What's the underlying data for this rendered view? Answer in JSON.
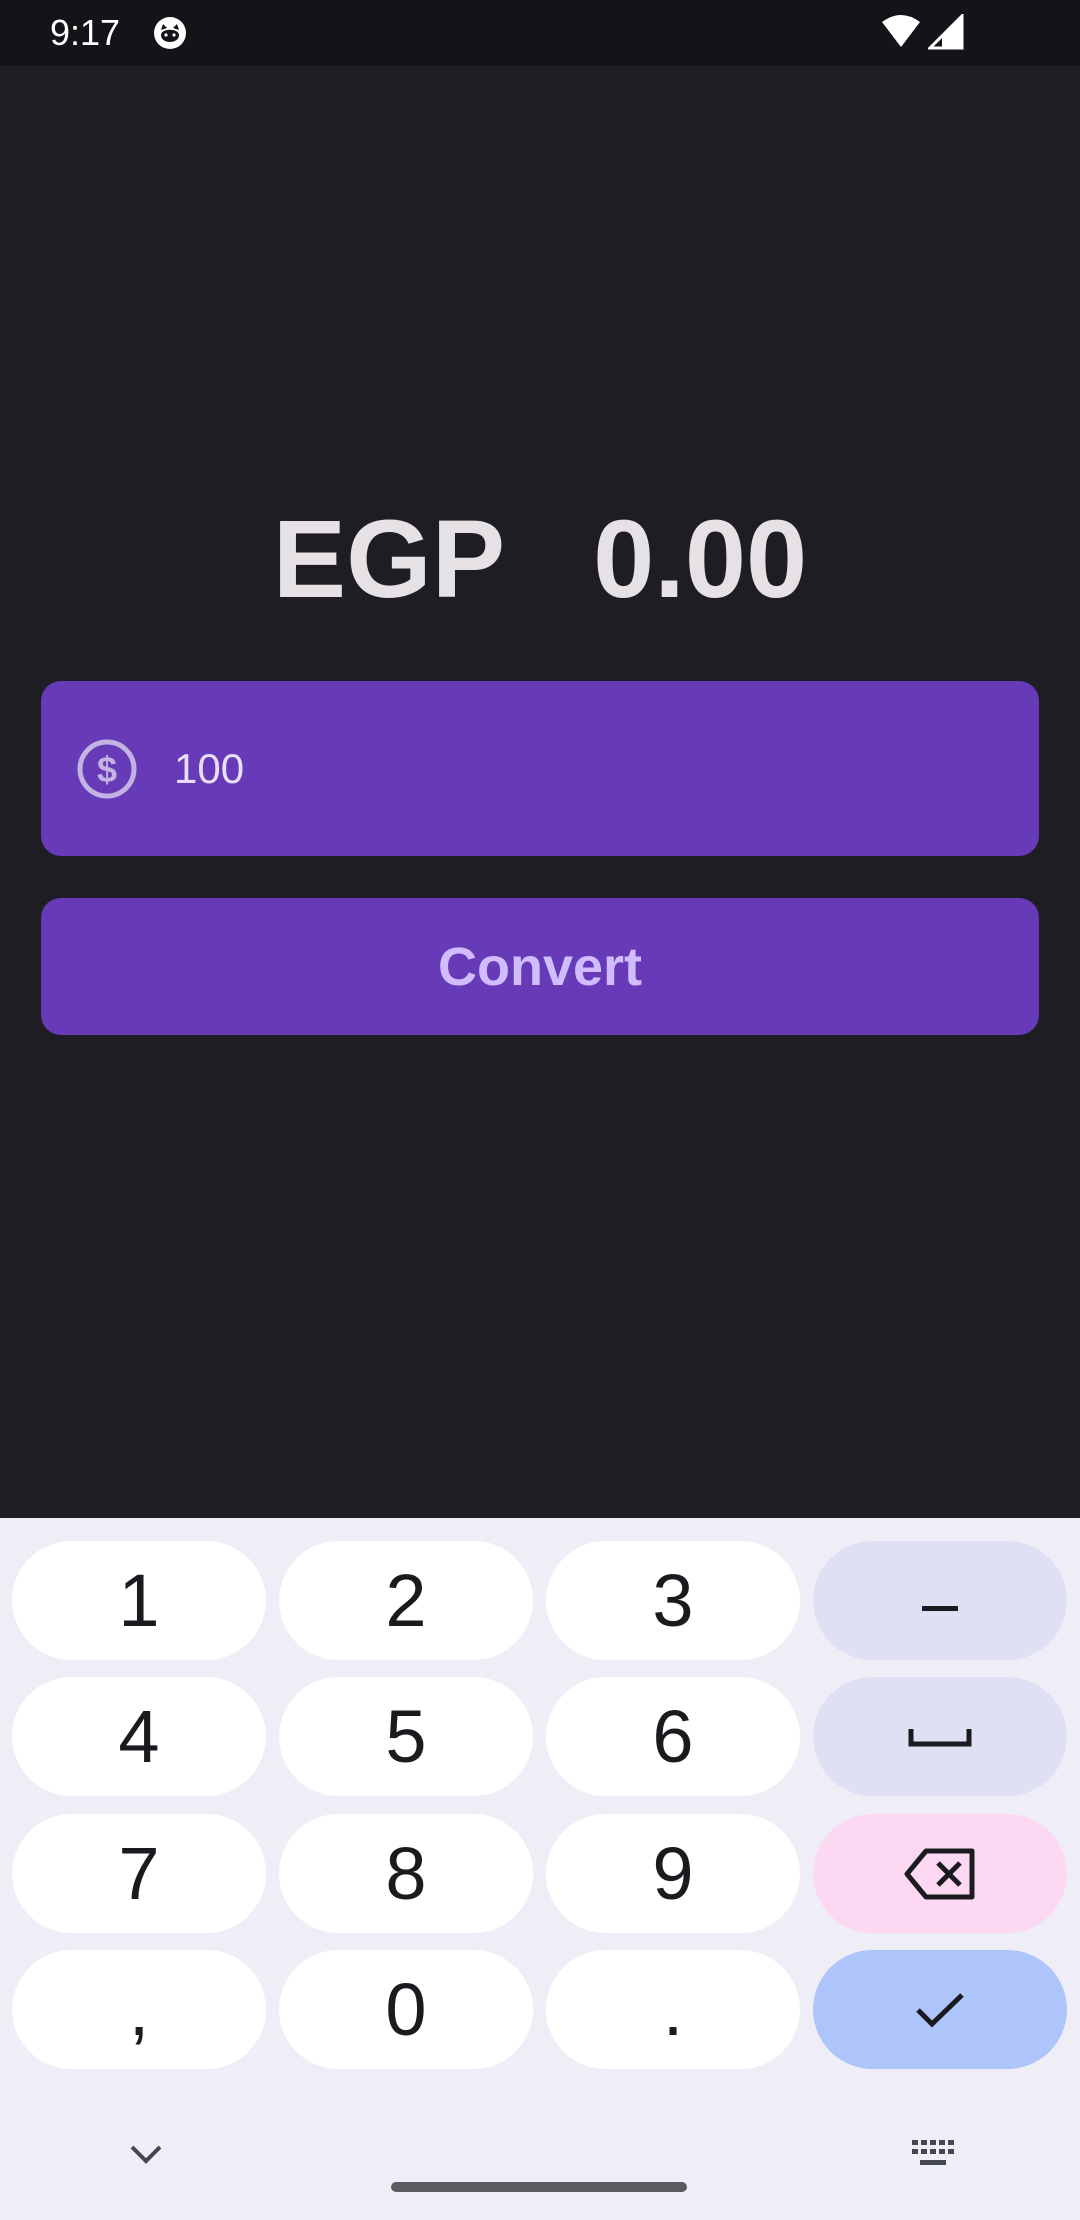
{
  "status_bar": {
    "time": "9:17"
  },
  "result": {
    "currency": "EGP",
    "amount": "0.00"
  },
  "amount_field": {
    "value": "100",
    "icon": "dollar-circle-icon"
  },
  "convert_button": {
    "label": "Convert"
  },
  "keyboard": {
    "digit_keys": [
      "1",
      "2",
      "3",
      "4",
      "5",
      "6",
      "7",
      "8",
      "9",
      ",",
      "0",
      "."
    ],
    "function_keys": [
      "minus-key",
      "space-key",
      "backspace-key",
      "done-key"
    ],
    "bottom_icons": [
      "chevron-down-icon",
      "keyboard-icon"
    ]
  },
  "colors": {
    "background": "#1e1d23",
    "status_bar": "#141317",
    "accent": "#673ab7",
    "button_text": "#d0bcff",
    "keyboard_bg": "#efeef6",
    "key_delete": "#fcd8f2",
    "key_done": "#adc5fb"
  }
}
